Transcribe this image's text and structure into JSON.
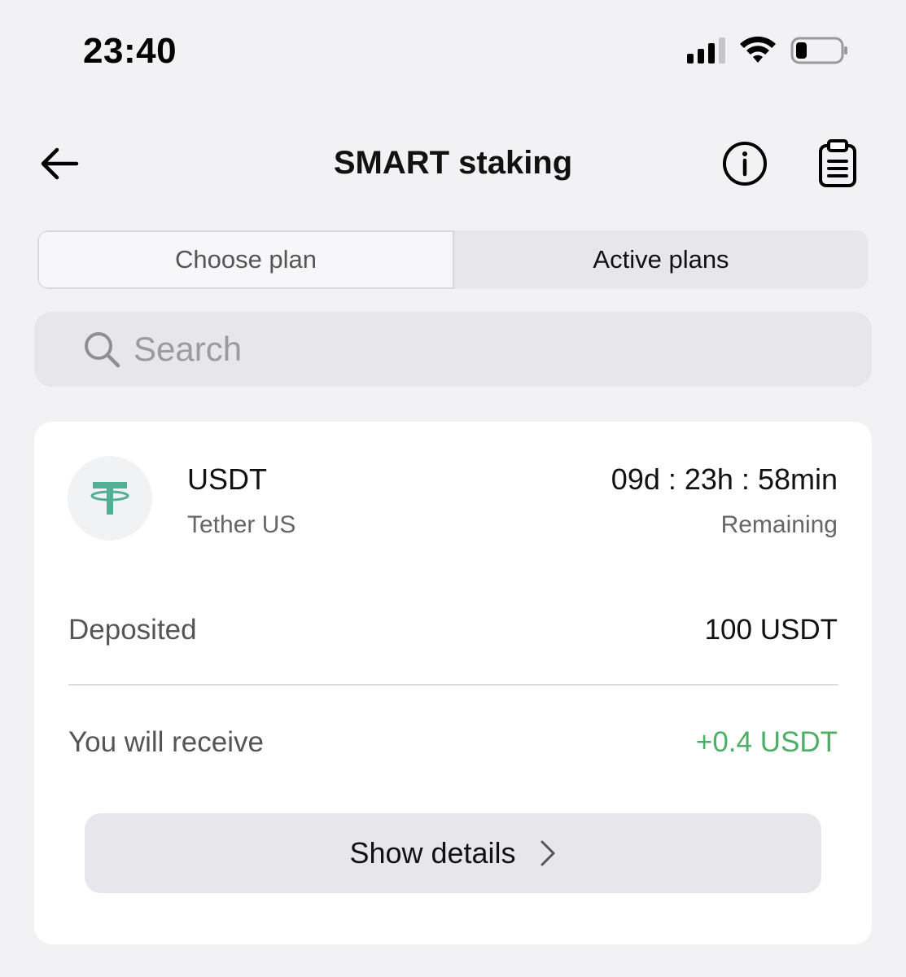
{
  "status_bar": {
    "time": "23:40",
    "icons": [
      "cellular-signal-icon",
      "wifi-icon",
      "battery-icon"
    ]
  },
  "header": {
    "title": "SMART staking",
    "icons": [
      "back-arrow-icon",
      "info-icon",
      "clipboard-icon"
    ]
  },
  "tabs": [
    {
      "label": "Choose plan",
      "active": false
    },
    {
      "label": "Active plans",
      "active": true
    }
  ],
  "search": {
    "placeholder": "Search"
  },
  "plan": {
    "symbol": "USDT",
    "name": "Tether US",
    "timer": "09d : 23h : 58min",
    "timer_label": "Remaining",
    "deposited_label": "Deposited",
    "deposited_value": "100 USDT",
    "receive_label": "You will receive",
    "receive_value": "+0.4 USDT",
    "details_button": "Show details"
  },
  "colors": {
    "background": "#f2f2f4",
    "card": "#ffffff",
    "accent_green": "#4caf65",
    "tether_green": "#50af95"
  }
}
